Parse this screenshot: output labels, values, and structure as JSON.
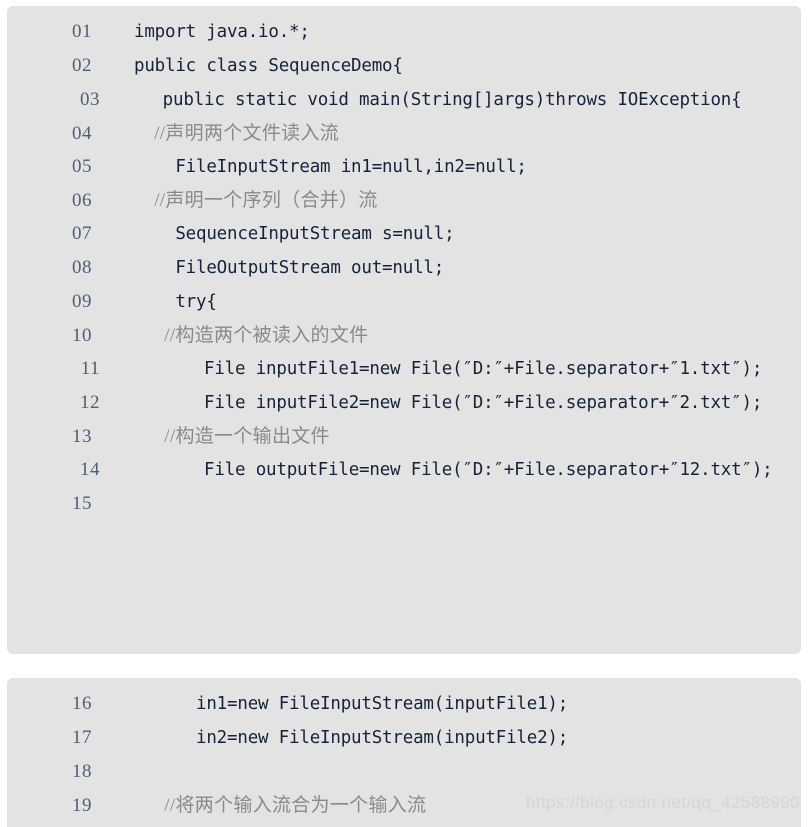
{
  "document": {
    "language": "java",
    "background_color": "#ffffff",
    "code_block_color": "#e3e3e3",
    "line_number_color": "#4b5f79",
    "code_text_color": "#14233b",
    "comment_color": "#8a8a8a"
  },
  "watermark": {
    "text": "https://blog.csdn.net/qq_42588990",
    "color": "#d5d5d5"
  },
  "blocks": [
    {
      "id": "code-block-1",
      "lines": [
        {
          "number": "01",
          "indent": "none",
          "kind": "code",
          "text": "import java.io.*;"
        },
        {
          "number": "02",
          "indent": "none",
          "kind": "code",
          "text": "public class SequenceDemo{"
        },
        {
          "number": "03",
          "indent": "deep",
          "kind": "code",
          "text": "  public static void main(String[]args)throws IOException{"
        },
        {
          "number": "04",
          "indent": "none",
          "kind": "comment",
          "text": "    //声明两个文件读入流"
        },
        {
          "number": "05",
          "indent": "none",
          "kind": "code",
          "text": "    FileInputStream in1=null,in2=null;"
        },
        {
          "number": "06",
          "indent": "none",
          "kind": "comment",
          "text": "    //声明一个序列（合并）流"
        },
        {
          "number": "07",
          "indent": "none",
          "kind": "code",
          "text": "    SequenceInputStream s=null;"
        },
        {
          "number": "08",
          "indent": "none",
          "kind": "code",
          "text": "    FileOutputStream out=null;"
        },
        {
          "number": "09",
          "indent": "none",
          "kind": "code",
          "text": "    try{"
        },
        {
          "number": "10",
          "indent": "none",
          "kind": "comment",
          "text": "      //构造两个被读入的文件"
        },
        {
          "number": "11",
          "indent": "deep",
          "kind": "code",
          "text": "      File inputFile1=new File(″D:″+File.separator+″1.txt″);"
        },
        {
          "number": "12",
          "indent": "deep",
          "kind": "code",
          "text": "      File inputFile2=new File(″D:″+File.separator+″2.txt″);"
        },
        {
          "number": "13",
          "indent": "none",
          "kind": "comment",
          "text": "      //构造一个输出文件"
        },
        {
          "number": "14",
          "indent": "deep",
          "kind": "code",
          "text": "      File outputFile=new File(″D:″+File.separator+″12.txt″);"
        },
        {
          "number": "15",
          "indent": "none",
          "kind": "code",
          "text": ""
        }
      ]
    },
    {
      "id": "code-block-2",
      "lines": [
        {
          "number": "16",
          "indent": "none",
          "kind": "code",
          "text": "      in1=new FileInputStream(inputFile1);"
        },
        {
          "number": "17",
          "indent": "none",
          "kind": "code",
          "text": "      in2=new FileInputStream(inputFile2);"
        },
        {
          "number": "18",
          "indent": "none",
          "kind": "code",
          "text": ""
        },
        {
          "number": "19",
          "indent": "none",
          "kind": "comment",
          "text": "      //将两个输入流合为一个输入流"
        }
      ]
    }
  ]
}
